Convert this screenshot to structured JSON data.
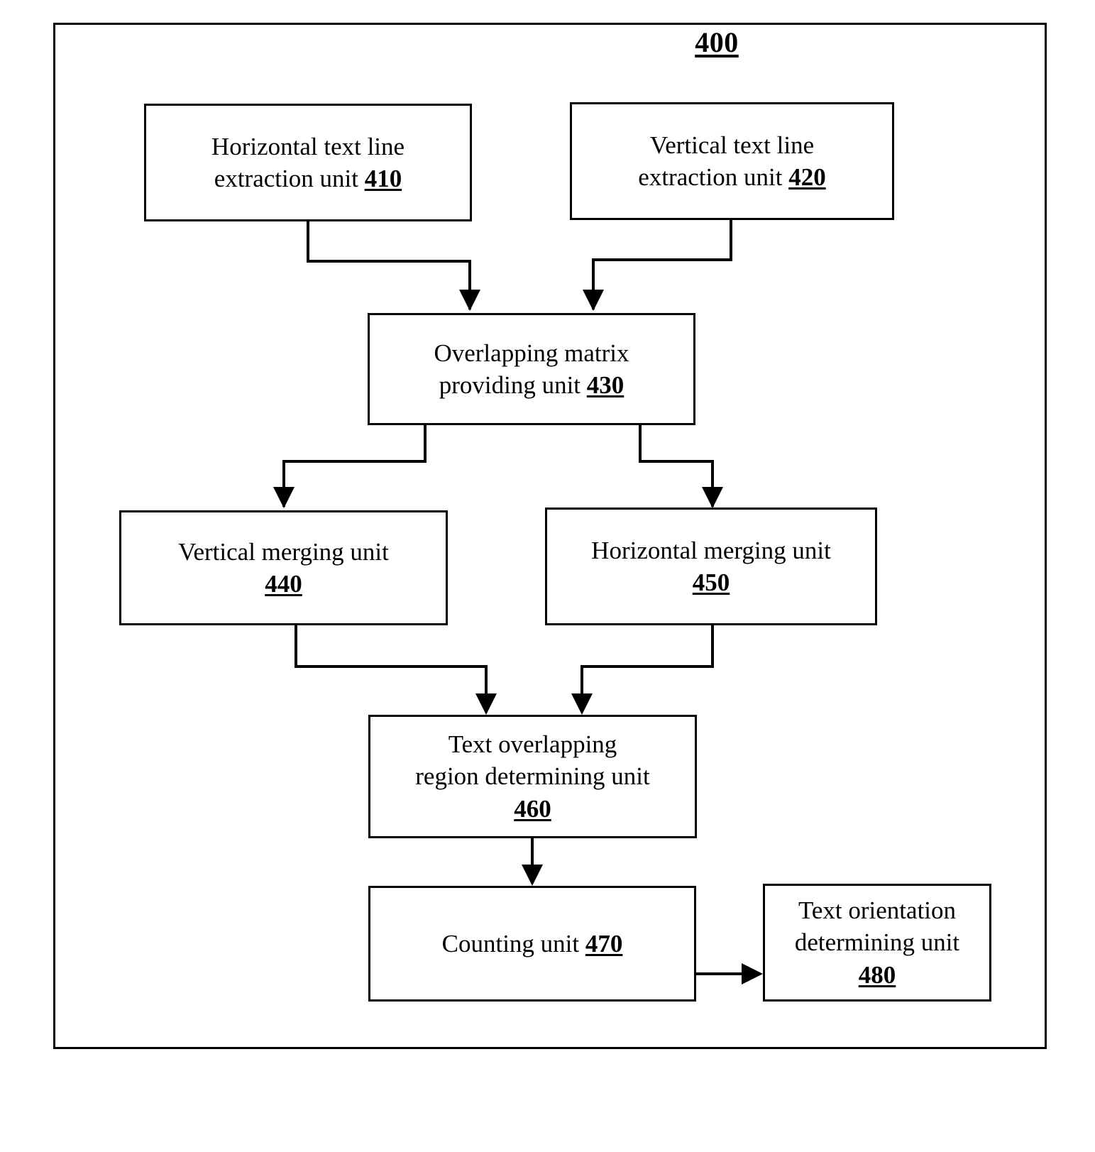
{
  "figure": {
    "number": "400",
    "type": "block-diagram"
  },
  "nodes": [
    {
      "id": "410",
      "name": "horizontal-text-line-extraction-unit",
      "line1": "Horizontal text line",
      "line2": "extraction unit ",
      "ref": "410"
    },
    {
      "id": "420",
      "name": "vertical-text-line-extraction-unit",
      "line1": "Vertical text line",
      "line2": "extraction unit ",
      "ref": "420"
    },
    {
      "id": "430",
      "name": "overlapping-matrix-providing-unit",
      "line1": "Overlapping matrix",
      "line2": "providing unit ",
      "ref": "430"
    },
    {
      "id": "440",
      "name": "vertical-merging-unit",
      "line1": "Vertical merging unit",
      "line2": "",
      "ref": "440"
    },
    {
      "id": "450",
      "name": "horizontal-merging-unit",
      "line1": "Horizontal merging unit",
      "line2": "",
      "ref": "450"
    },
    {
      "id": "460",
      "name": "text-overlapping-region-determining-unit",
      "line1": "Text overlapping",
      "line2": "region determining unit",
      "ref": "460"
    },
    {
      "id": "470",
      "name": "counting-unit",
      "line1": "Counting unit ",
      "line2": "",
      "ref": "470"
    },
    {
      "id": "480",
      "name": "text-orientation-determining-unit",
      "line1": "Text orientation",
      "line2": "determining unit",
      "ref": "480"
    }
  ],
  "edges": [
    {
      "from": "410",
      "to": "430"
    },
    {
      "from": "420",
      "to": "430"
    },
    {
      "from": "430",
      "to": "440"
    },
    {
      "from": "430",
      "to": "450"
    },
    {
      "from": "440",
      "to": "460"
    },
    {
      "from": "450",
      "to": "460"
    },
    {
      "from": "460",
      "to": "470"
    },
    {
      "from": "470",
      "to": "480"
    }
  ],
  "colors": {
    "stroke": "#000000",
    "background": "#ffffff"
  }
}
